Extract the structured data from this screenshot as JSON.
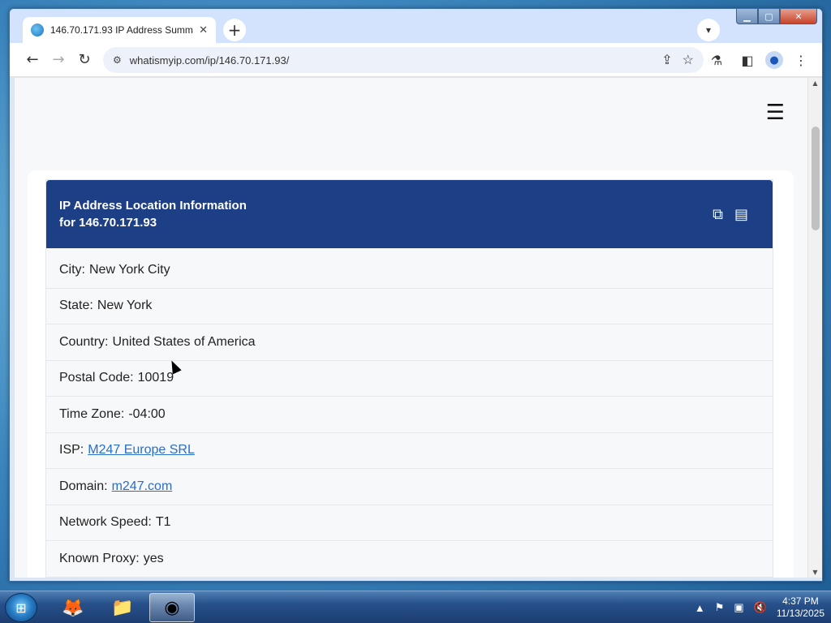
{
  "browser": {
    "tab_title": "146.70.171.93 IP Address Summ",
    "url": "whatismyip.com/ip/146.70.171.93/"
  },
  "card": {
    "title_line1": "IP Address Location Information",
    "title_line2": "for 146.70.171.93",
    "rows": [
      {
        "label": "City:",
        "value": "New York City"
      },
      {
        "label": "State:",
        "value": "New York"
      },
      {
        "label": "Country:",
        "value": "United States of America"
      },
      {
        "label": "Postal Code:",
        "value": "10019"
      },
      {
        "label": "Time Zone:",
        "value": "-04:00"
      },
      {
        "label": "ISP:",
        "value": "M247 Europe SRL"
      },
      {
        "label": "Domain:",
        "value": "m247.com"
      },
      {
        "label": "Network Speed:",
        "value": "T1"
      },
      {
        "label": "Known Proxy:",
        "value": "yes"
      }
    ]
  },
  "taskbar": {
    "time": "4:37 PM",
    "date": "11/13/2025"
  },
  "colors": {
    "card_header": "#1d3f86",
    "link": "#2a6dc9"
  }
}
